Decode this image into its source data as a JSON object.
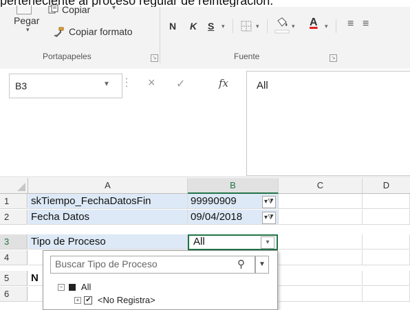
{
  "top_caption": "perteneciente al proceso regular de reintegración.",
  "ribbon": {
    "paste_label": "Pegar",
    "copy_label": "Copiar",
    "copy_format_label": "Copiar formato",
    "clipboard_group": "Portapapeles",
    "font_group": "Fuente",
    "bold": "N",
    "italic": "K",
    "underline": "S"
  },
  "formula_bar": {
    "name_box": "B3",
    "cancel": "×",
    "enter": "✓",
    "fx": "fx",
    "content": "All"
  },
  "grid": {
    "columns": [
      "A",
      "B",
      "C",
      "D"
    ],
    "rows": [
      {
        "num": "1",
        "a": "skTiempo_FechaDatosFin",
        "b": "99990909"
      },
      {
        "num": "2",
        "a": "Fecha Datos",
        "b": "09/04/2018"
      },
      {
        "num": "3",
        "a": "Tipo de Proceso",
        "b": "All"
      },
      {
        "num": "4",
        "a": "",
        "b": ""
      },
      {
        "num": "5",
        "a": "N",
        "b": ""
      },
      {
        "num": "6",
        "a": "",
        "b": ""
      }
    ]
  },
  "dropdown": {
    "search_placeholder": "Buscar Tipo de Proceso",
    "tree": [
      {
        "label": "All"
      },
      {
        "label": "<No Registra>"
      }
    ]
  }
}
